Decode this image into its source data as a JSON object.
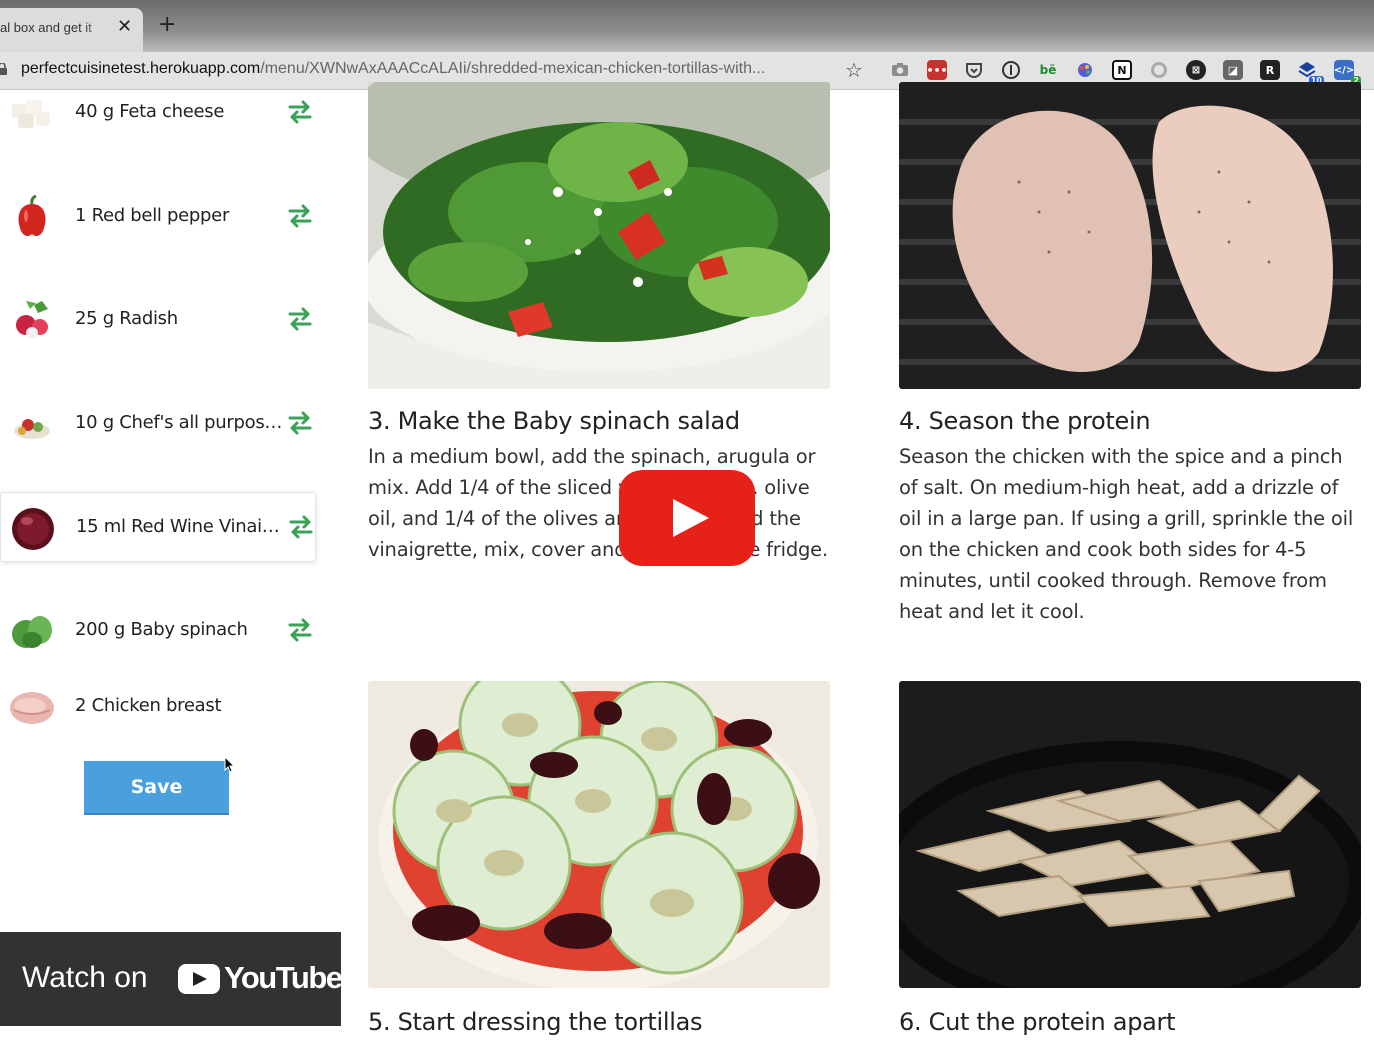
{
  "browser": {
    "tab_title": "al box and get it",
    "tab_close": "✕",
    "new_tab": "+",
    "url_host": "perfectcuisinetest.herokuapp.com",
    "url_path": "/menu/XWNwAxAAACcALAIi/shredded-mexican-chicken-tortillas-with...",
    "star": "☆",
    "extensions": [
      {
        "name": "camera-icon"
      },
      {
        "name": "lastpass-icon"
      },
      {
        "name": "pocket-icon"
      },
      {
        "name": "onepassword-icon"
      },
      {
        "name": "behance-icon"
      },
      {
        "name": "palette-icon"
      },
      {
        "name": "notion-icon"
      },
      {
        "name": "clock-icon"
      },
      {
        "name": "mixmax-icon"
      },
      {
        "name": "puzzle-icon"
      },
      {
        "name": "r-icon"
      },
      {
        "name": "layers-icon",
        "badge": "10"
      },
      {
        "name": "code-icon",
        "badge": "2"
      }
    ]
  },
  "sidebar": {
    "ingredients": [
      {
        "amount": "40 g",
        "name": "Feta cheese",
        "image": "feta-image"
      },
      {
        "amount": "1",
        "name": "Red bell pepper",
        "image": "pepper-image"
      },
      {
        "amount": "25 g",
        "name": "Radish",
        "image": "radish-image"
      },
      {
        "amount": "10 g",
        "name": "Chef's all purpose ...",
        "image": "spice-image"
      },
      {
        "amount": "15 ml",
        "name": "Red Wine Vinaigr...",
        "image": "vinaigrette-image"
      },
      {
        "amount": "200 g",
        "name": "Baby spinach",
        "image": "spinach-image"
      },
      {
        "amount": "2",
        "name": "Chicken breast",
        "image": "chicken-image"
      }
    ],
    "save_label": "Save"
  },
  "steps": [
    {
      "title": "3. Make the Baby spinach salad",
      "body": "In a medium bowl, add the spinach, arugula or mix. Add 1/4 of the sliced veggies, 1 tsp. olive oil, and 1/4 of the olives and cheese. Add the vinaigrette, mix, cover and store it in the fridge."
    },
    {
      "title": "4. Season the protein",
      "body": "Season the chicken with the spice and a pinch of salt. On medium-high heat, add a drizzle of oil in a large pan. If using a grill, sprinkle the oil on the chicken and cook both sides for 4-5 minutes, until cooked through. Remove from heat and let it cool."
    },
    {
      "title": "5. Start dressing the tortillas"
    },
    {
      "title": "6. Cut the protein apart"
    }
  ],
  "youtube": {
    "watch_on": "Watch on",
    "brand": "YouTube"
  },
  "colors": {
    "save_button": "#4a9fdd",
    "swap_icon": "#3aa357",
    "youtube_red": "#e62117"
  }
}
